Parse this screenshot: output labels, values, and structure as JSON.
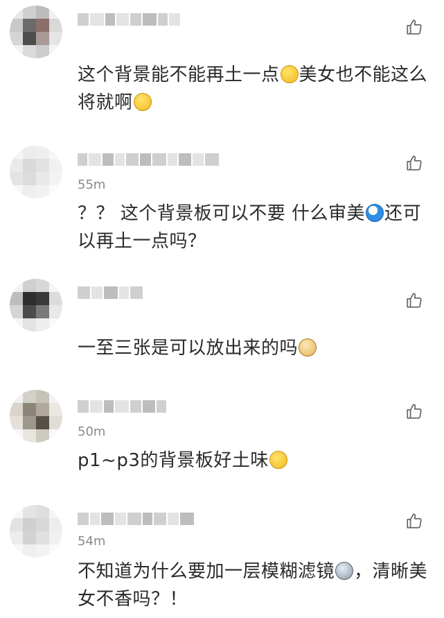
{
  "comments": [
    {
      "time": "",
      "text_parts": [
        "这个背景能不能再土一点",
        "美女也不能这么将就啊",
        ""
      ],
      "emojis": [
        "smirk-emoji",
        "unamused-emoji"
      ]
    },
    {
      "time": "55m",
      "text_parts": [
        "？？ 这个背景板可以不要 什么审美",
        "还可以再土一点吗？"
      ],
      "emojis": [
        "doraemon-emoji"
      ]
    },
    {
      "time": "",
      "text_parts": [
        "一至三张是可以放出来的吗",
        ""
      ],
      "emojis": [
        "doge-emoji"
      ]
    },
    {
      "time": "50m",
      "text_parts": [
        "p1~p3的背景板好土味",
        ""
      ],
      "emojis": [
        "laughing-crying-emoji"
      ]
    },
    {
      "time": "54m",
      "text_parts": [
        "不知道为什么要加一层模糊滤镜",
        "，清晰美女不香吗？！"
      ],
      "emojis": [
        "screaming-emoji"
      ]
    }
  ]
}
